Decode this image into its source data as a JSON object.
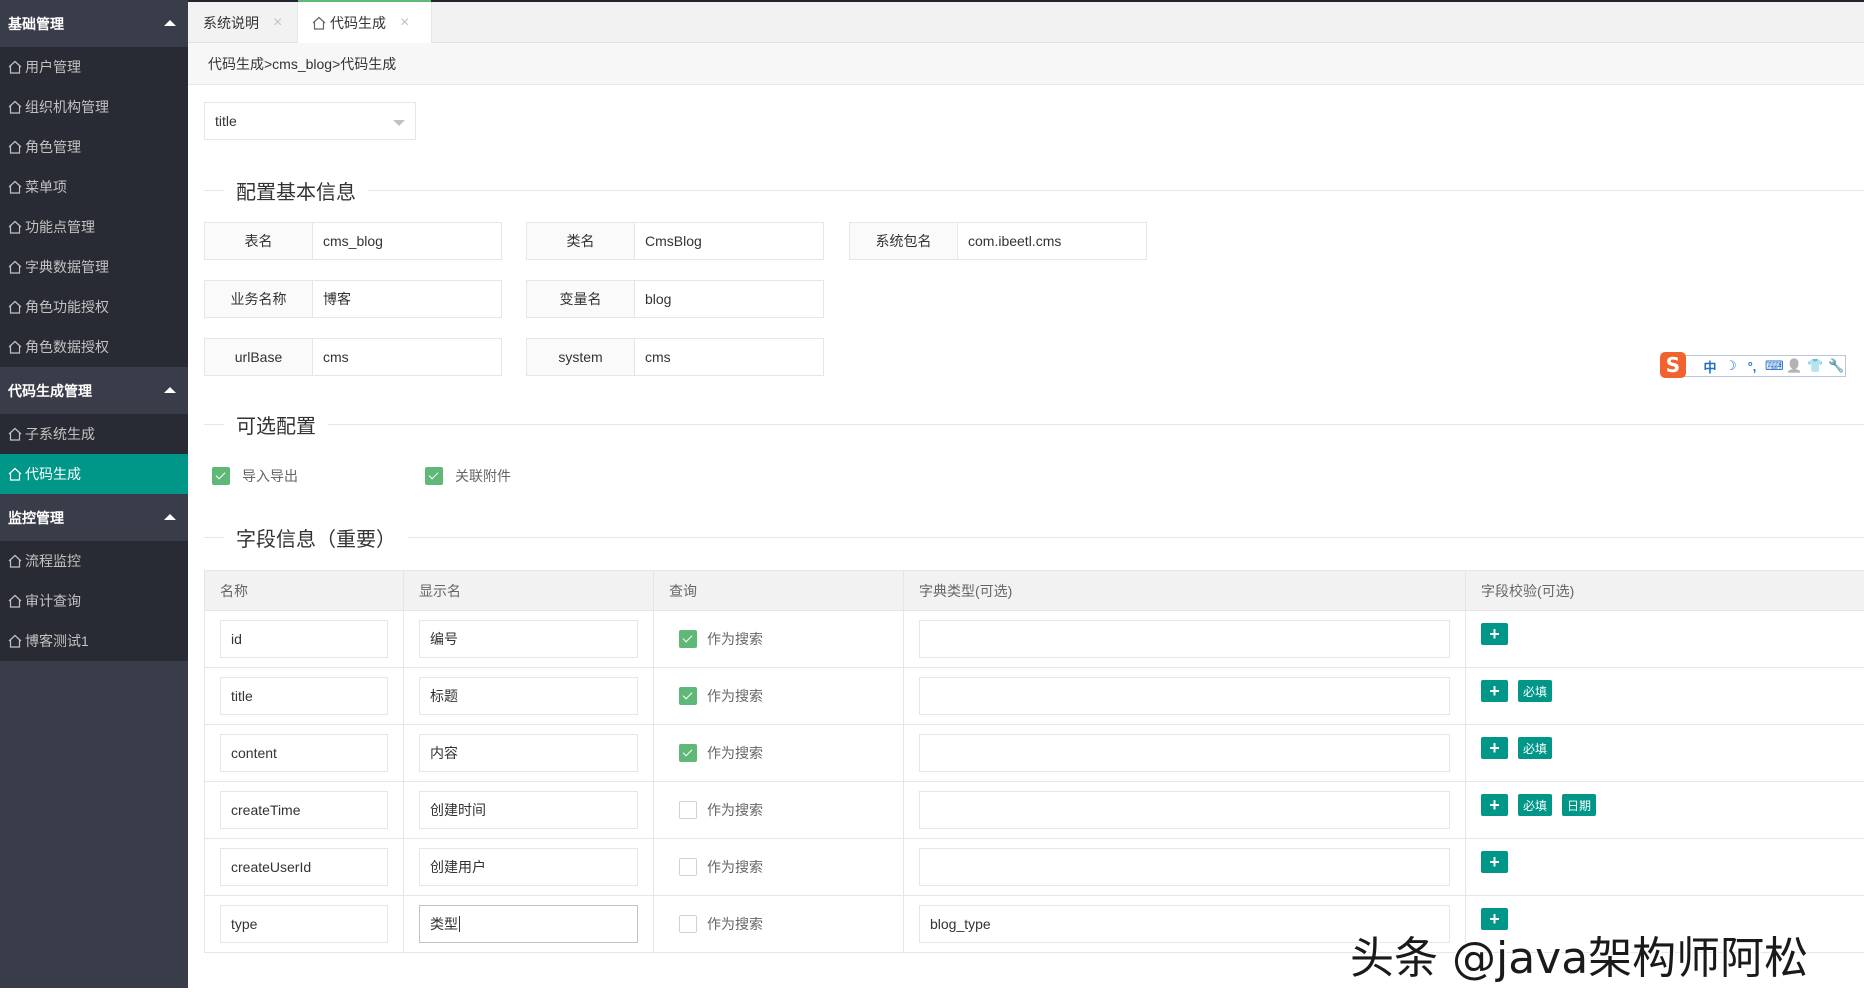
{
  "sidebar": {
    "groups": [
      {
        "label": "基础管理",
        "items": [
          "用户管理",
          "组织机构管理",
          "角色管理",
          "菜单项",
          "功能点管理",
          "字典数据管理",
          "角色功能授权",
          "角色数据授权"
        ]
      },
      {
        "label": "代码生成管理",
        "items": [
          "子系统生成",
          "代码生成"
        ]
      },
      {
        "label": "监控管理",
        "items": [
          "流程监控",
          "审计查询",
          "博客测试1"
        ]
      }
    ],
    "active_item": "代码生成"
  },
  "tabs": [
    {
      "label": "系统说明",
      "close": "×"
    },
    {
      "label": "代码生成",
      "close": "×",
      "active": true
    }
  ],
  "breadcrumb": "代码生成>cms_blog>代码生成",
  "select": {
    "value": "title"
  },
  "sections": {
    "basic": "配置基本信息",
    "optional": "可选配置",
    "fields": "字段信息（重要）"
  },
  "basic_form": [
    {
      "label": "表名",
      "value": "cms_blog"
    },
    {
      "label": "类名",
      "value": "CmsBlog"
    },
    {
      "label": "系统包名",
      "value": "com.ibeetl.cms"
    },
    {
      "label": "业务名称",
      "value": "博客"
    },
    {
      "label": "变量名",
      "value": "blog"
    },
    {
      "label": "urlBase",
      "value": "cms"
    },
    {
      "label": "system",
      "value": "cms"
    }
  ],
  "optional_checks": [
    {
      "label": "导入导出",
      "checked": true
    },
    {
      "label": "关联附件",
      "checked": true
    }
  ],
  "table": {
    "headers": [
      "名称",
      "显示名",
      "查询",
      "字典类型(可选)",
      "字段校验(可选)"
    ],
    "search_label": "作为搜索",
    "add_label": "+",
    "rows": [
      {
        "name": "id",
        "display": "编号",
        "search": true,
        "dict": "",
        "validators": []
      },
      {
        "name": "title",
        "display": "标题",
        "search": true,
        "dict": "",
        "validators": [
          "必填"
        ]
      },
      {
        "name": "content",
        "display": "内容",
        "search": true,
        "dict": "",
        "validators": [
          "必填"
        ]
      },
      {
        "name": "createTime",
        "display": "创建时间",
        "search": false,
        "dict": "",
        "validators": [
          "必填",
          "日期"
        ]
      },
      {
        "name": "createUserId",
        "display": "创建用户",
        "search": false,
        "dict": "",
        "validators": []
      },
      {
        "name": "type",
        "display": "类型",
        "search": false,
        "dict": "blog_type",
        "validators": []
      }
    ]
  },
  "ime_toolbar": {
    "logo": "S",
    "items": [
      "中",
      "☽",
      "°,",
      "⌨",
      "👤",
      "👕",
      "🔧"
    ]
  },
  "watermark": "头条 @java架构师阿松",
  "colors": {
    "accent": "#009688",
    "check": "#5fb878",
    "sidebar": "#393d49",
    "sidebar_items": "#282b33"
  }
}
